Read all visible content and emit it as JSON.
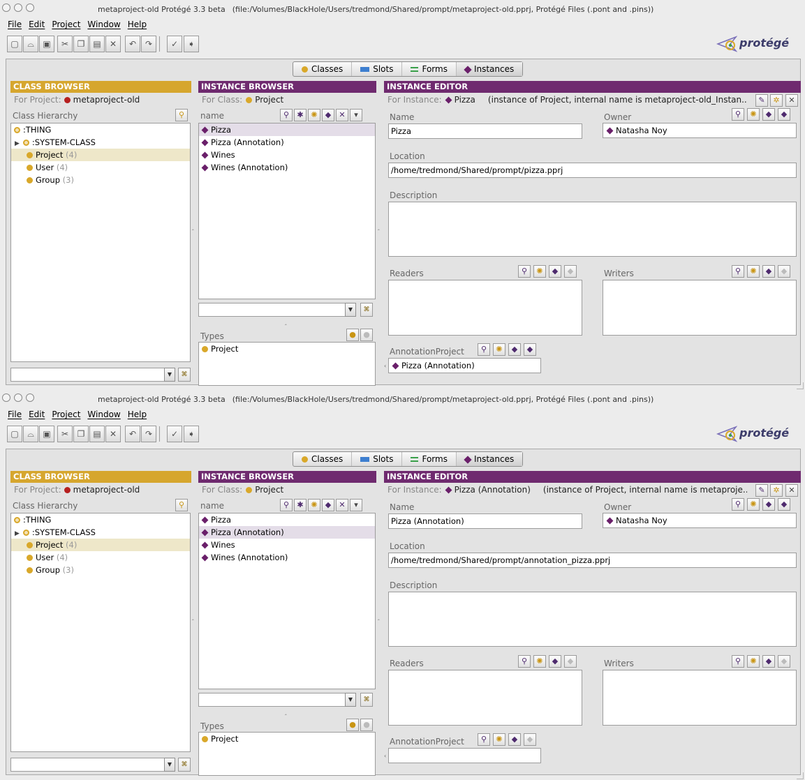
{
  "windows": [
    {
      "title": "metaproject-old  Protégé 3.3 beta",
      "subtitle": "(file:/Volumes/BlackHole/Users/tredmond/Shared/prompt/metaproject-old.pprj, Protégé Files (.pont and .pins))",
      "menus": [
        "File",
        "Edit",
        "Project",
        "Window",
        "Help"
      ],
      "logo_text": "protégé",
      "tabs": [
        "Classes",
        "Slots",
        "Forms",
        "Instances"
      ],
      "active_tab": "Instances",
      "class_browser": {
        "header": "CLASS BROWSER",
        "for_label": "For Project:",
        "for_value": "metaproject-old",
        "hierarchy_label": "Class Hierarchy",
        "items": [
          {
            "label": ":THING",
            "count": ""
          },
          {
            "label": ":SYSTEM-CLASS",
            "count": ""
          },
          {
            "label": "Project",
            "count": "(4)"
          },
          {
            "label": "User",
            "count": "(4)"
          },
          {
            "label": "Group",
            "count": "(3)"
          }
        ]
      },
      "instance_browser": {
        "header": "INSTANCE BROWSER",
        "for_label": "For Class:",
        "for_value": "Project",
        "column_label": "name",
        "items": [
          "Pizza",
          "Pizza (Annotation)",
          "Wines",
          "Wines (Annotation)"
        ],
        "types_label": "Types",
        "types": [
          "Project"
        ]
      },
      "instance_editor": {
        "header": "INSTANCE EDITOR",
        "for_label": "For Instance:",
        "for_value": "Pizza",
        "for_detail": "(instance of Project, internal name is metaproject-old_Instan...",
        "name_label": "Name",
        "name_value": "Pizza",
        "owner_label": "Owner",
        "owner_value": "Natasha Noy",
        "location_label": "Location",
        "location_value": "/home/tredmond/Shared/prompt/pizza.pprj",
        "description_label": "Description",
        "readers_label": "Readers",
        "writers_label": "Writers",
        "annotation_label": "AnnotationProject",
        "annotation_value": "Pizza (Annotation)"
      }
    },
    {
      "title": "metaproject-old  Protégé 3.3 beta",
      "subtitle": "(file:/Volumes/BlackHole/Users/tredmond/Shared/prompt/metaproject-old.pprj, Protégé Files (.pont and .pins))",
      "menus": [
        "File",
        "Edit",
        "Project",
        "Window",
        "Help"
      ],
      "logo_text": "protégé",
      "tabs": [
        "Classes",
        "Slots",
        "Forms",
        "Instances"
      ],
      "active_tab": "Instances",
      "class_browser": {
        "header": "CLASS BROWSER",
        "for_label": "For Project:",
        "for_value": "metaproject-old",
        "hierarchy_label": "Class Hierarchy",
        "items": [
          {
            "label": ":THING",
            "count": ""
          },
          {
            "label": ":SYSTEM-CLASS",
            "count": ""
          },
          {
            "label": "Project",
            "count": "(4)"
          },
          {
            "label": "User",
            "count": "(4)"
          },
          {
            "label": "Group",
            "count": "(3)"
          }
        ]
      },
      "instance_browser": {
        "header": "INSTANCE BROWSER",
        "for_label": "For Class:",
        "for_value": "Project",
        "column_label": "name",
        "items": [
          "Pizza",
          "Pizza (Annotation)",
          "Wines",
          "Wines (Annotation)"
        ],
        "types_label": "Types",
        "types": [
          "Project"
        ]
      },
      "instance_editor": {
        "header": "INSTANCE EDITOR",
        "for_label": "For Instance:",
        "for_value": "Pizza (Annotation)",
        "for_detail": "(instance of Project, internal name is metaproje...",
        "name_label": "Name",
        "name_value": "Pizza (Annotation)",
        "owner_label": "Owner",
        "owner_value": "Natasha Noy",
        "location_label": "Location",
        "location_value": "/home/tredmond/Shared/prompt/annotation_pizza.pprj",
        "description_label": "Description",
        "readers_label": "Readers",
        "writers_label": "Writers",
        "annotation_label": "AnnotationProject",
        "annotation_value": ""
      }
    }
  ],
  "icons": {
    "window_lights": "traffic-light-icons",
    "toolbar": [
      "new-project-icon",
      "open-project-icon",
      "save-project-icon",
      "cut-icon",
      "copy-icon",
      "paste-icon",
      "delete-icon",
      "undo-icon",
      "redo-icon",
      "check-icon",
      "forward-icon"
    ],
    "colors": {
      "class_accent": "#d6a62e",
      "instance_accent": "#6f2a6f",
      "project_dot": "#b62020"
    }
  }
}
